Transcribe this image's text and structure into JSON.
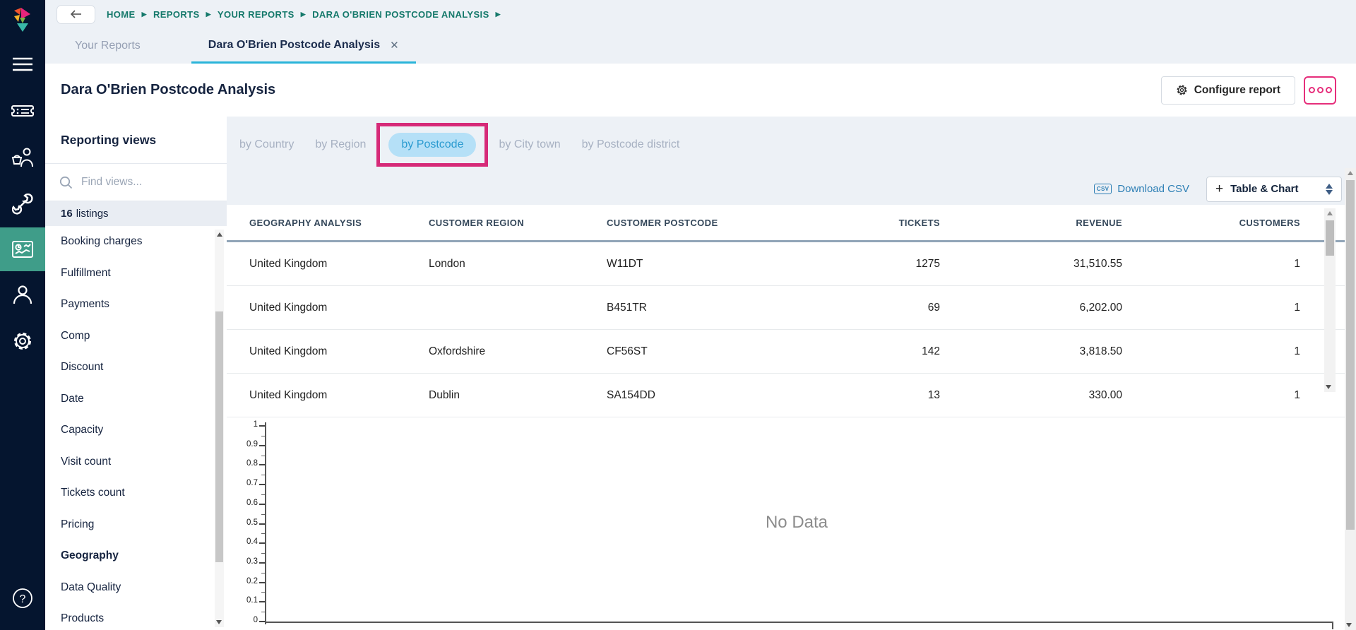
{
  "app": {
    "name": "ticketing-reports-app"
  },
  "icons": {
    "logo": "ticketsolve-colored-arrow",
    "menu": "hamburger",
    "tickets": "ticket",
    "box_office": "basket-person",
    "tools": "wrench",
    "reports": "dashboard-chart",
    "customers": "person",
    "settings": "gear",
    "help": "question-mark-circle",
    "back": "arrow-left",
    "search": "magnifier",
    "csv": "csv-badge",
    "plus": "plus",
    "sort": "up-down-triangles",
    "close": "x"
  },
  "breadcrumb": {
    "items": [
      "HOME",
      "REPORTS",
      "YOUR REPORTS",
      "DARA O'BRIEN POSTCODE ANALYSIS"
    ]
  },
  "tabs": {
    "inactive": "Your Reports",
    "active": "Dara O'Brien Postcode Analysis",
    "close": "✕"
  },
  "header": {
    "title": "Dara O'Brien Postcode Analysis",
    "configure_button": "Configure report"
  },
  "reporting_views": {
    "title": "Reporting views",
    "search_placeholder": "Find views...",
    "count": "16",
    "count_label": "listings",
    "items": [
      "Booking charges",
      "Fulfillment",
      "Payments",
      "Comp",
      "Discount",
      "Date",
      "Capacity",
      "Visit count",
      "Tickets count",
      "Pricing",
      "Geography",
      "Data Quality",
      "Products"
    ],
    "selected_item": "Geography"
  },
  "geo_tabs": {
    "items": [
      "by Country",
      "by Region",
      "by Postcode",
      "by City town",
      "by Postcode district"
    ],
    "active": "by Postcode"
  },
  "toolbar": {
    "csv_badge": "CSV",
    "download_csv": "Download CSV",
    "view_select": "Table & Chart"
  },
  "table": {
    "columns": [
      "GEOGRAPHY ANALYSIS",
      "CUSTOMER REGION",
      "CUSTOMER POSTCODE",
      "TICKETS",
      "REVENUE",
      "CUSTOMERS"
    ],
    "rows": [
      [
        "United Kingdom",
        "London",
        "W11DT",
        "1275",
        "31,510.55",
        "1"
      ],
      [
        "United Kingdom",
        "",
        "B451TR",
        "69",
        "6,202.00",
        "1"
      ],
      [
        "United Kingdom",
        "Oxfordshire",
        "CF56ST",
        "142",
        "3,818.50",
        "1"
      ],
      [
        "United Kingdom",
        "Dublin",
        "SA154DD",
        "13",
        "330.00",
        "1"
      ]
    ]
  },
  "chart_data": {
    "type": "bar",
    "title": "",
    "categories": [],
    "series": [],
    "ylim": [
      0,
      1
    ],
    "y_ticks": [
      "1",
      "0.9",
      "0.8",
      "0.7",
      "0.6",
      "0.5",
      "0.4",
      "0.3",
      "0.2",
      "0.1",
      "0"
    ],
    "grid": false,
    "legend": "none",
    "no_data_label": "No Data"
  },
  "colors": {
    "sidebar_bg": "#05152f",
    "active_nav_bg": "#3f9d89",
    "breadcrumb_text": "#15796b",
    "tab_underline": "#2ab4d9",
    "pill_bg": "#b5e0f7",
    "pill_text": "#2b9bd0",
    "annotation_pink": "#d62a78",
    "more_button_pink": "#e62e7b",
    "link_blue": "#2d7fb5",
    "header_border": "#91a5b8"
  }
}
